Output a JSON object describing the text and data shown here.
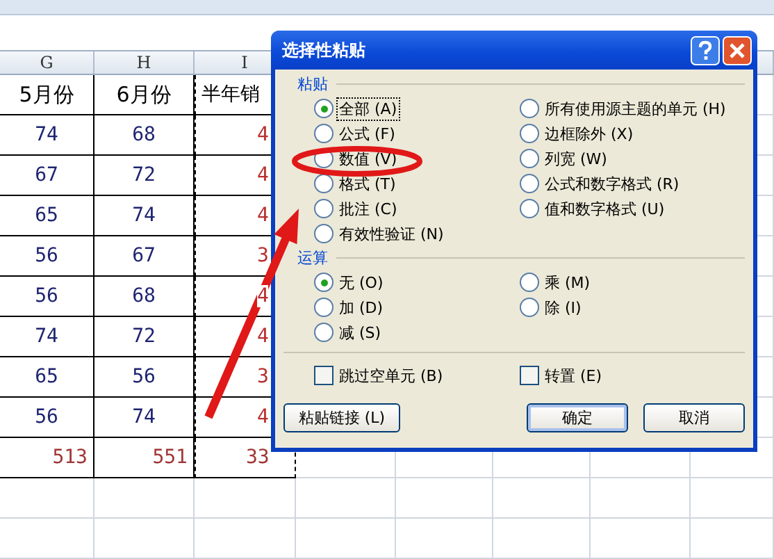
{
  "sheet": {
    "columns": [
      "G",
      "H",
      "I"
    ],
    "header": [
      "5月份",
      "6月份",
      "半年销"
    ],
    "rows": [
      [
        "74",
        "68",
        "4"
      ],
      [
        "67",
        "72",
        "4"
      ],
      [
        "65",
        "74",
        "4"
      ],
      [
        "56",
        "67",
        "3"
      ],
      [
        "56",
        "68",
        "4"
      ],
      [
        "74",
        "72",
        "4"
      ],
      [
        "65",
        "56",
        "3"
      ],
      [
        "56",
        "74",
        "4"
      ]
    ],
    "totals": [
      "513",
      "551",
      "33"
    ]
  },
  "dialog": {
    "title": "选择性粘贴",
    "paste": {
      "label": "粘贴",
      "options": [
        {
          "label": "全部 (A)",
          "selected": true
        },
        {
          "label": "公式 (F)",
          "selected": false
        },
        {
          "label": "数值 (V)",
          "selected": false
        },
        {
          "label": "格式 (T)",
          "selected": false
        },
        {
          "label": "批注 (C)",
          "selected": false
        },
        {
          "label": "有效性验证 (N)",
          "selected": false
        },
        {
          "label": "所有使用源主题的单元 (H)",
          "selected": false
        },
        {
          "label": "边框除外 (X)",
          "selected": false
        },
        {
          "label": "列宽 (W)",
          "selected": false
        },
        {
          "label": "公式和数字格式 (R)",
          "selected": false
        },
        {
          "label": "值和数字格式 (U)",
          "selected": false
        }
      ]
    },
    "operation": {
      "label": "运算",
      "options": [
        {
          "label": "无 (O)",
          "selected": true
        },
        {
          "label": "加 (D)",
          "selected": false
        },
        {
          "label": "减 (S)",
          "selected": false
        },
        {
          "label": "乘 (M)",
          "selected": false
        },
        {
          "label": "除 (I)",
          "selected": false
        }
      ]
    },
    "checkboxes": [
      {
        "label": "跳过空单元 (B)",
        "checked": false
      },
      {
        "label": "转置 (E)",
        "checked": false
      }
    ],
    "buttons": [
      "粘贴链接 (L)",
      "确定",
      "取消"
    ]
  }
}
